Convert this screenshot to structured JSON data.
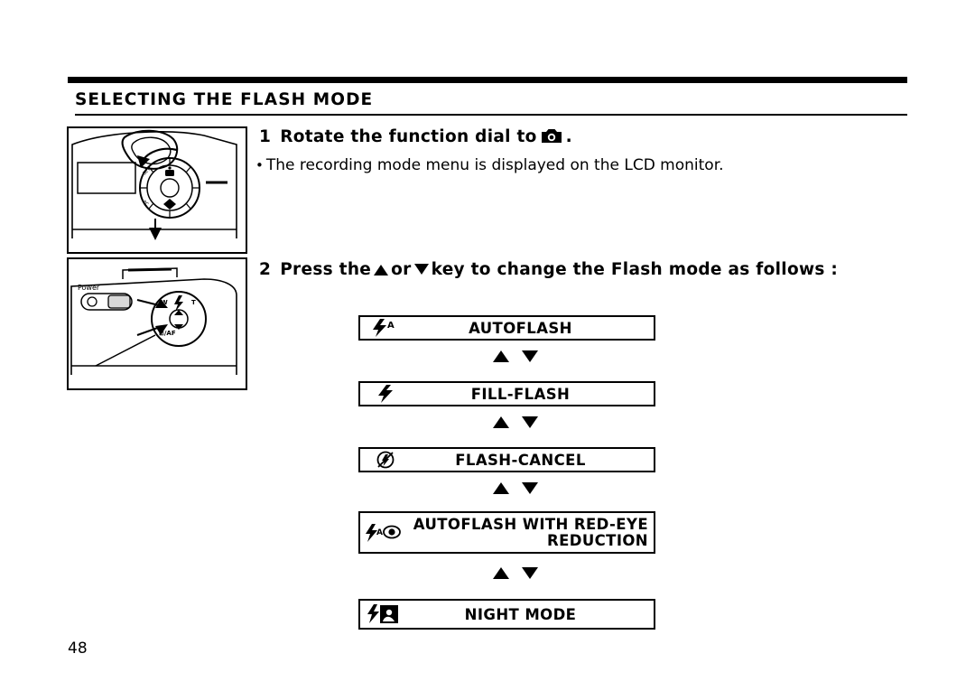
{
  "document": {
    "section_title": "SELECTING THE FLASH MODE",
    "page_number": "48"
  },
  "steps": [
    {
      "number": "1",
      "text_before": "Rotate the function dial to",
      "icon": "camera-icon",
      "text_after": ".",
      "bullet": "The recording mode menu is displayed on the LCD monitor."
    },
    {
      "number": "2",
      "text_before": "Press the",
      "icon_up": "triangle-up-icon",
      "text_middle": "or",
      "icon_down": "triangle-down-icon",
      "text_after": "key to change the Flash mode as follows :"
    }
  ],
  "flash_modes": [
    {
      "icon": "flash-auto-icon",
      "label": "AUTOFLASH"
    },
    {
      "icon": "flash-icon",
      "label": "FILL-FLASH"
    },
    {
      "icon": "flash-cancel-icon",
      "label": "FLASH-CANCEL"
    },
    {
      "icon": "flash-auto-redeye-icon",
      "label": "AUTOFLASH WITH RED-EYE",
      "label2": "REDUCTION"
    },
    {
      "icon": "flash-night-icon",
      "label": "NIGHT MODE"
    }
  ],
  "illustrations": [
    {
      "name": "camera-top-function-dial",
      "labels": []
    },
    {
      "name": "camera-rear-arrow-keys",
      "labels": [
        "Power"
      ]
    }
  ]
}
